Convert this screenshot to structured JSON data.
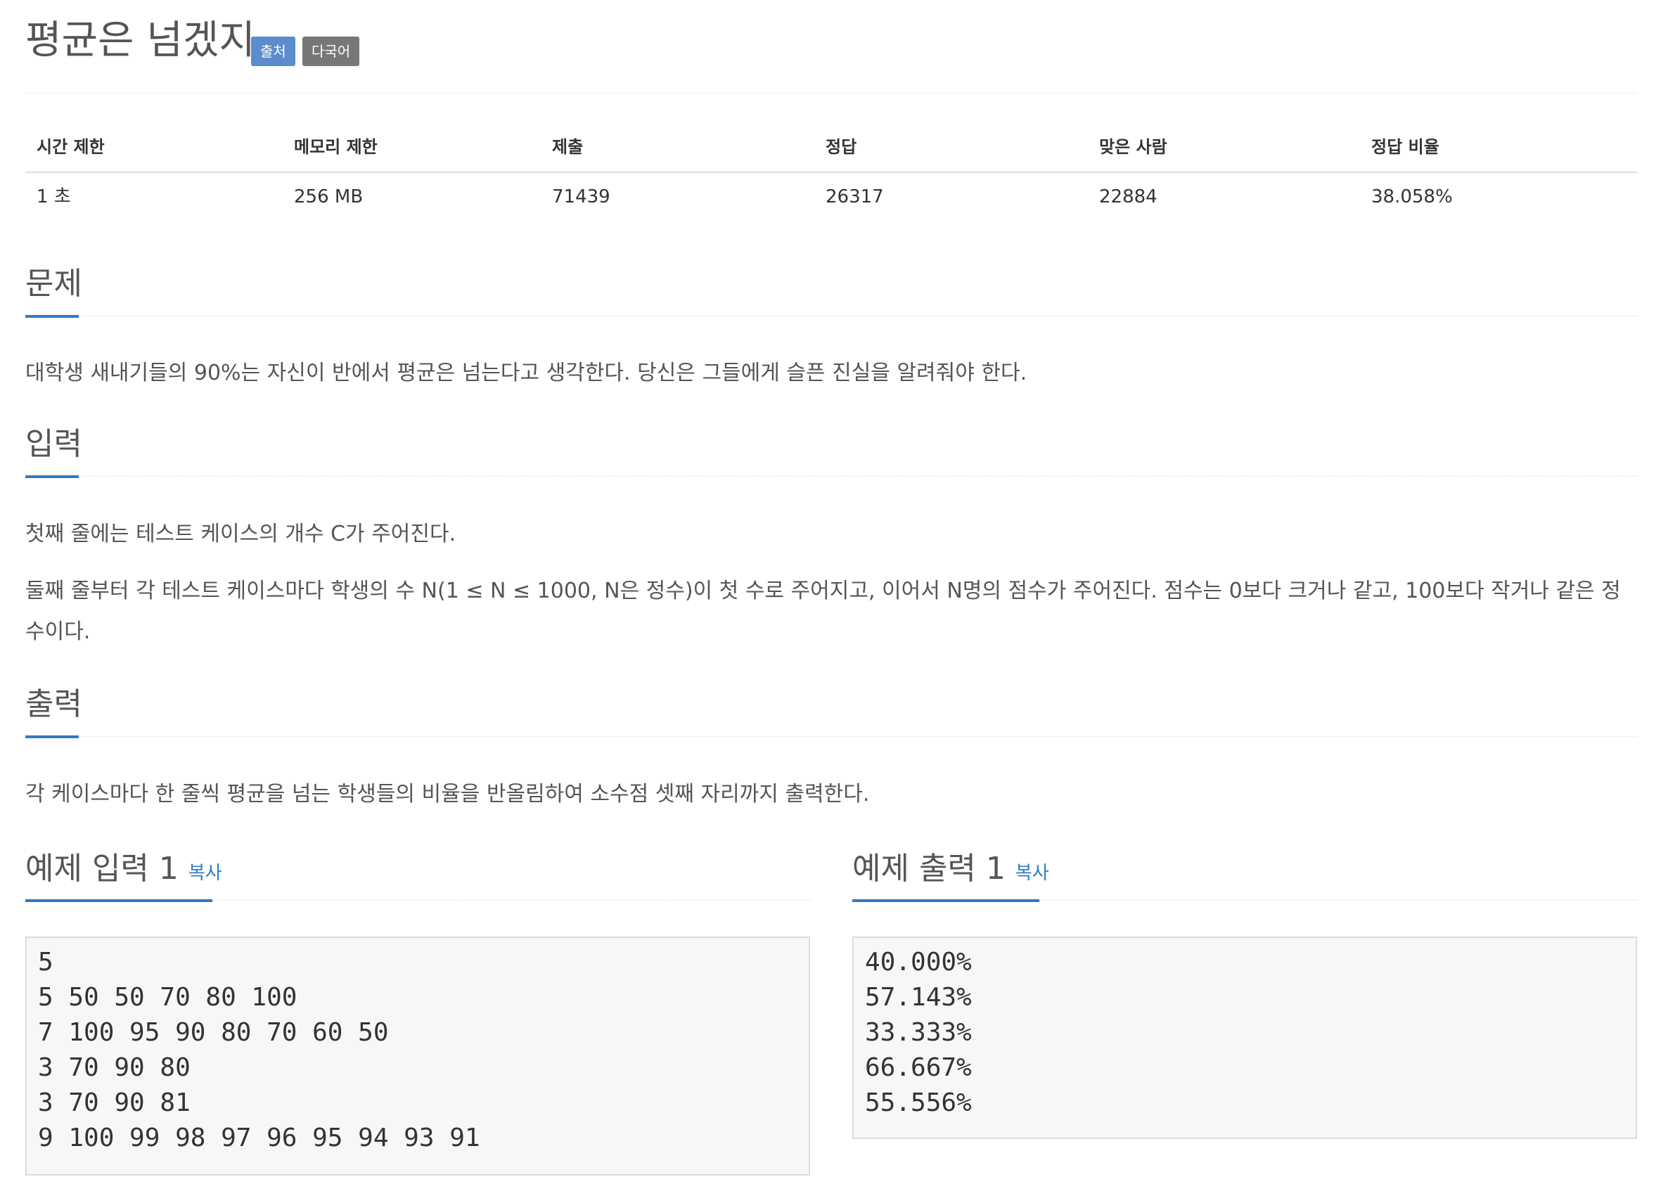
{
  "problem": {
    "title": "평균은 넘겠지",
    "labels": {
      "source": "출처",
      "multilang": "다국어"
    }
  },
  "stats": {
    "headers": [
      "시간 제한",
      "메모리 제한",
      "제출",
      "정답",
      "맞은 사람",
      "정답 비율"
    ],
    "values": [
      "1 초",
      "256 MB",
      "71439",
      "26317",
      "22884",
      "38.058%"
    ]
  },
  "sections": {
    "description": {
      "title": "문제",
      "text": "대학생 새내기들의 90%는 자신이 반에서 평균은 넘는다고 생각한다. 당신은 그들에게 슬픈 진실을 알려줘야 한다."
    },
    "input": {
      "title": "입력",
      "paragraphs": [
        "첫째 줄에는 테스트 케이스의 개수 C가 주어진다.",
        "둘째 줄부터 각 테스트 케이스마다 학생의 수 N(1 ≤ N ≤ 1000, N은 정수)이 첫 수로 주어지고, 이어서 N명의 점수가 주어진다. 점수는 0보다 크거나 같고, 100보다 작거나 같은 정수이다."
      ]
    },
    "output": {
      "title": "출력",
      "text": "각 케이스마다 한 줄씩 평균을 넘는 학생들의 비율을 반올림하여 소수점 셋째 자리까지 출력한다."
    }
  },
  "samples": {
    "input": {
      "title": "예제 입력 1",
      "copy_label": "복사",
      "lines": [
        "5",
        "5 50 50 70 80 100",
        "7 100 95 90 80 70 60 50",
        "3 70 90 80",
        "3 70 90 81",
        "9 100 99 98 97 96 95 94 93 91"
      ]
    },
    "output": {
      "title": "예제 출력 1",
      "copy_label": "복사",
      "lines": [
        "40.000%",
        "57.143%",
        "33.333%",
        "66.667%",
        "55.556%"
      ]
    }
  },
  "colors": {
    "accent": "#2f7bc5",
    "label_source": "#5b8ccc",
    "label_multilang": "#777777",
    "sample_background": "#f6f7f9"
  }
}
